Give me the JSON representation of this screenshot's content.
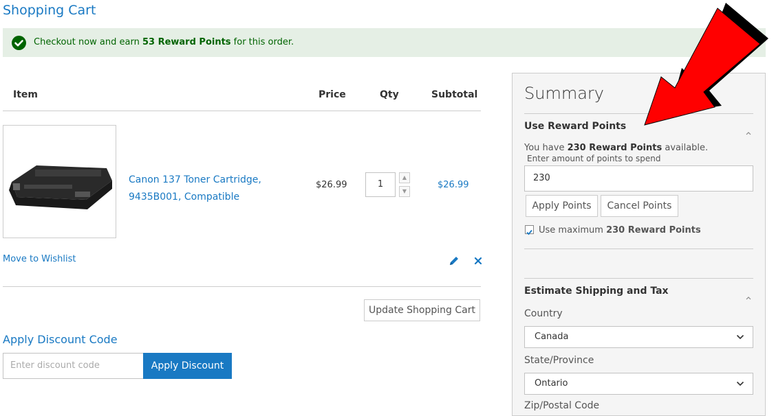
{
  "page": {
    "title": "Shopping Cart"
  },
  "banner": {
    "text_before": "Checkout now and earn ",
    "points_text": "53 Reward Points",
    "text_after": " for this order."
  },
  "table": {
    "headers": {
      "item": "Item",
      "price": "Price",
      "qty": "Qty",
      "subtotal": "Subtotal"
    }
  },
  "cart_item": {
    "name_line1": "Canon 137 Toner Cartridge,",
    "name_line2": "9435B001, Compatible",
    "price": "$26.99",
    "qty": "1",
    "subtotal": "$26.99",
    "move_to_wishlist": "Move to Wishlist"
  },
  "actions": {
    "update_cart": "Update Shopping Cart"
  },
  "discount": {
    "title": "Apply Discount Code",
    "placeholder": "Enter discount code",
    "button": "Apply Discount"
  },
  "summary": {
    "title": "Summary",
    "rewards": {
      "heading": "Use Reward Points",
      "have_before": "You have ",
      "have_points": "230 Reward Points",
      "have_after": " available.",
      "enter_label": "Enter amount of points to spend",
      "input_value": "230",
      "apply_button": "Apply Points",
      "cancel_button": "Cancel Points",
      "use_max_before": "Use maximum ",
      "use_max_points": "230 Reward Points",
      "use_max_checked": true
    },
    "shipping": {
      "heading": "Estimate Shipping and Tax",
      "country_label": "Country",
      "country_value": "Canada",
      "state_label": "State/Province",
      "state_value": "Ontario",
      "zip_label": "Zip/Postal Code"
    }
  },
  "colors": {
    "link": "#1979c3",
    "success_bg": "#e5efe5",
    "success_text": "#006400",
    "annotation_arrow": "#ff0000"
  }
}
